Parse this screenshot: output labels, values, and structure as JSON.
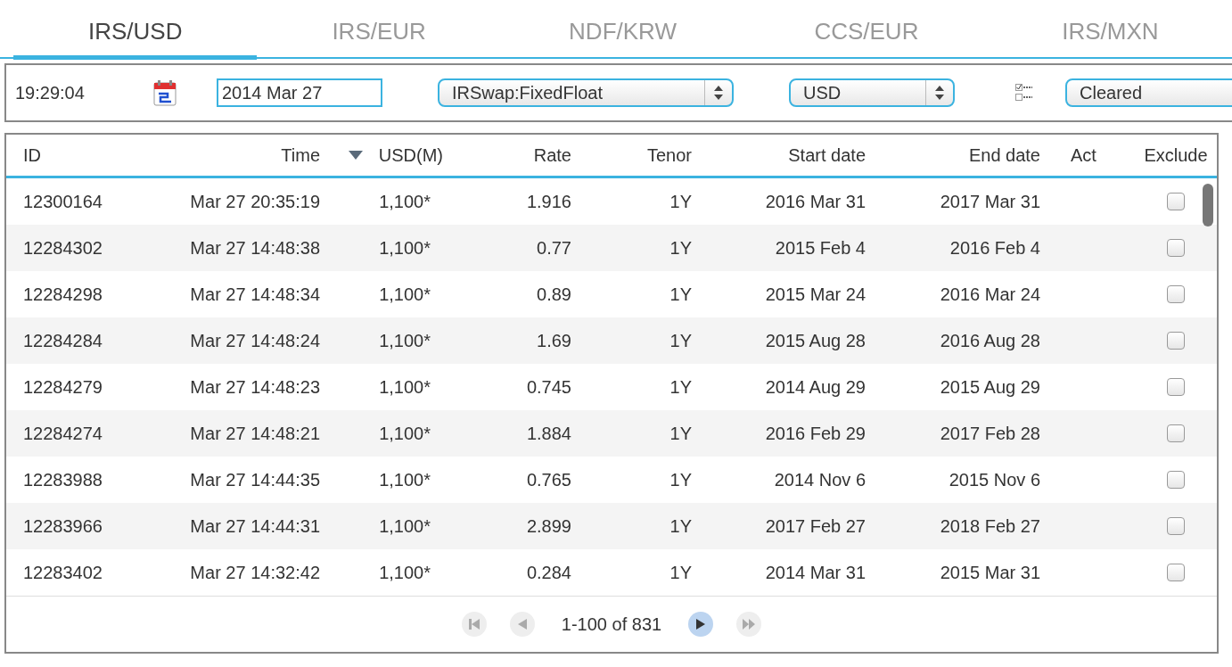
{
  "tabs": [
    {
      "label": "IRS/USD",
      "selected": true
    },
    {
      "label": "IRS/EUR",
      "selected": false
    },
    {
      "label": "NDF/KRW",
      "selected": false
    },
    {
      "label": "CCS/EUR",
      "selected": false
    },
    {
      "label": "IRS/MXN",
      "selected": false
    }
  ],
  "toolbar": {
    "time": "19:29:04",
    "date": {
      "value": "2014 Mar 27"
    },
    "product_select": {
      "value": "IRSwap:FixedFloat"
    },
    "currency_select": {
      "value": "USD"
    },
    "status_select": {
      "value": "Cleared"
    }
  },
  "table": {
    "columns": [
      {
        "label": "ID",
        "sorted": false
      },
      {
        "label": "Time",
        "sorted": false
      },
      {
        "label": "USD(M)",
        "sorted": true
      },
      {
        "label": "Rate",
        "sorted": false
      },
      {
        "label": "Tenor",
        "sorted": false
      },
      {
        "label": "Start date",
        "sorted": false
      },
      {
        "label": "End date",
        "sorted": false
      },
      {
        "label": "Act",
        "sorted": false
      },
      {
        "label": "Exclude",
        "sorted": false
      }
    ],
    "rows": [
      {
        "id": "12300164",
        "time": "Mar 27 20:35:19",
        "usd": "1,100*",
        "rate": "1.916",
        "tenor": "1Y",
        "start": "2016 Mar 31",
        "end": "2017 Mar 31",
        "exclude": false
      },
      {
        "id": "12284302",
        "time": "Mar 27 14:48:38",
        "usd": "1,100*",
        "rate": "0.77",
        "tenor": "1Y",
        "start": "2015 Feb 4",
        "end": "2016 Feb 4",
        "exclude": false
      },
      {
        "id": "12284298",
        "time": "Mar 27 14:48:34",
        "usd": "1,100*",
        "rate": "0.89",
        "tenor": "1Y",
        "start": "2015 Mar 24",
        "end": "2016 Mar 24",
        "exclude": false
      },
      {
        "id": "12284284",
        "time": "Mar 27 14:48:24",
        "usd": "1,100*",
        "rate": "1.69",
        "tenor": "1Y",
        "start": "2015 Aug 28",
        "end": "2016 Aug 28",
        "exclude": false
      },
      {
        "id": "12284279",
        "time": "Mar 27 14:48:23",
        "usd": "1,100*",
        "rate": "0.745",
        "tenor": "1Y",
        "start": "2014 Aug 29",
        "end": "2015 Aug 29",
        "exclude": false
      },
      {
        "id": "12284274",
        "time": "Mar 27 14:48:21",
        "usd": "1,100*",
        "rate": "1.884",
        "tenor": "1Y",
        "start": "2016 Feb 29",
        "end": "2017 Feb 28",
        "exclude": false
      },
      {
        "id": "12283988",
        "time": "Mar 27 14:44:35",
        "usd": "1,100*",
        "rate": "0.765",
        "tenor": "1Y",
        "start": "2014 Nov 6",
        "end": "2015 Nov 6",
        "exclude": false
      },
      {
        "id": "12283966",
        "time": "Mar 27 14:44:31",
        "usd": "1,100*",
        "rate": "2.899",
        "tenor": "1Y",
        "start": "2017 Feb 27",
        "end": "2018 Feb 27",
        "exclude": false
      },
      {
        "id": "12283402",
        "time": "Mar 27 14:32:42",
        "usd": "1,100*",
        "rate": "0.284",
        "tenor": "1Y",
        "start": "2014 Mar 31",
        "end": "2015 Mar 31",
        "exclude": false
      }
    ]
  },
  "pager": {
    "range": "1-100 of 831",
    "first": {
      "disabled": true
    },
    "prev": {
      "disabled": true
    },
    "next": {
      "disabled": false
    },
    "last": {
      "disabled": true
    }
  }
}
